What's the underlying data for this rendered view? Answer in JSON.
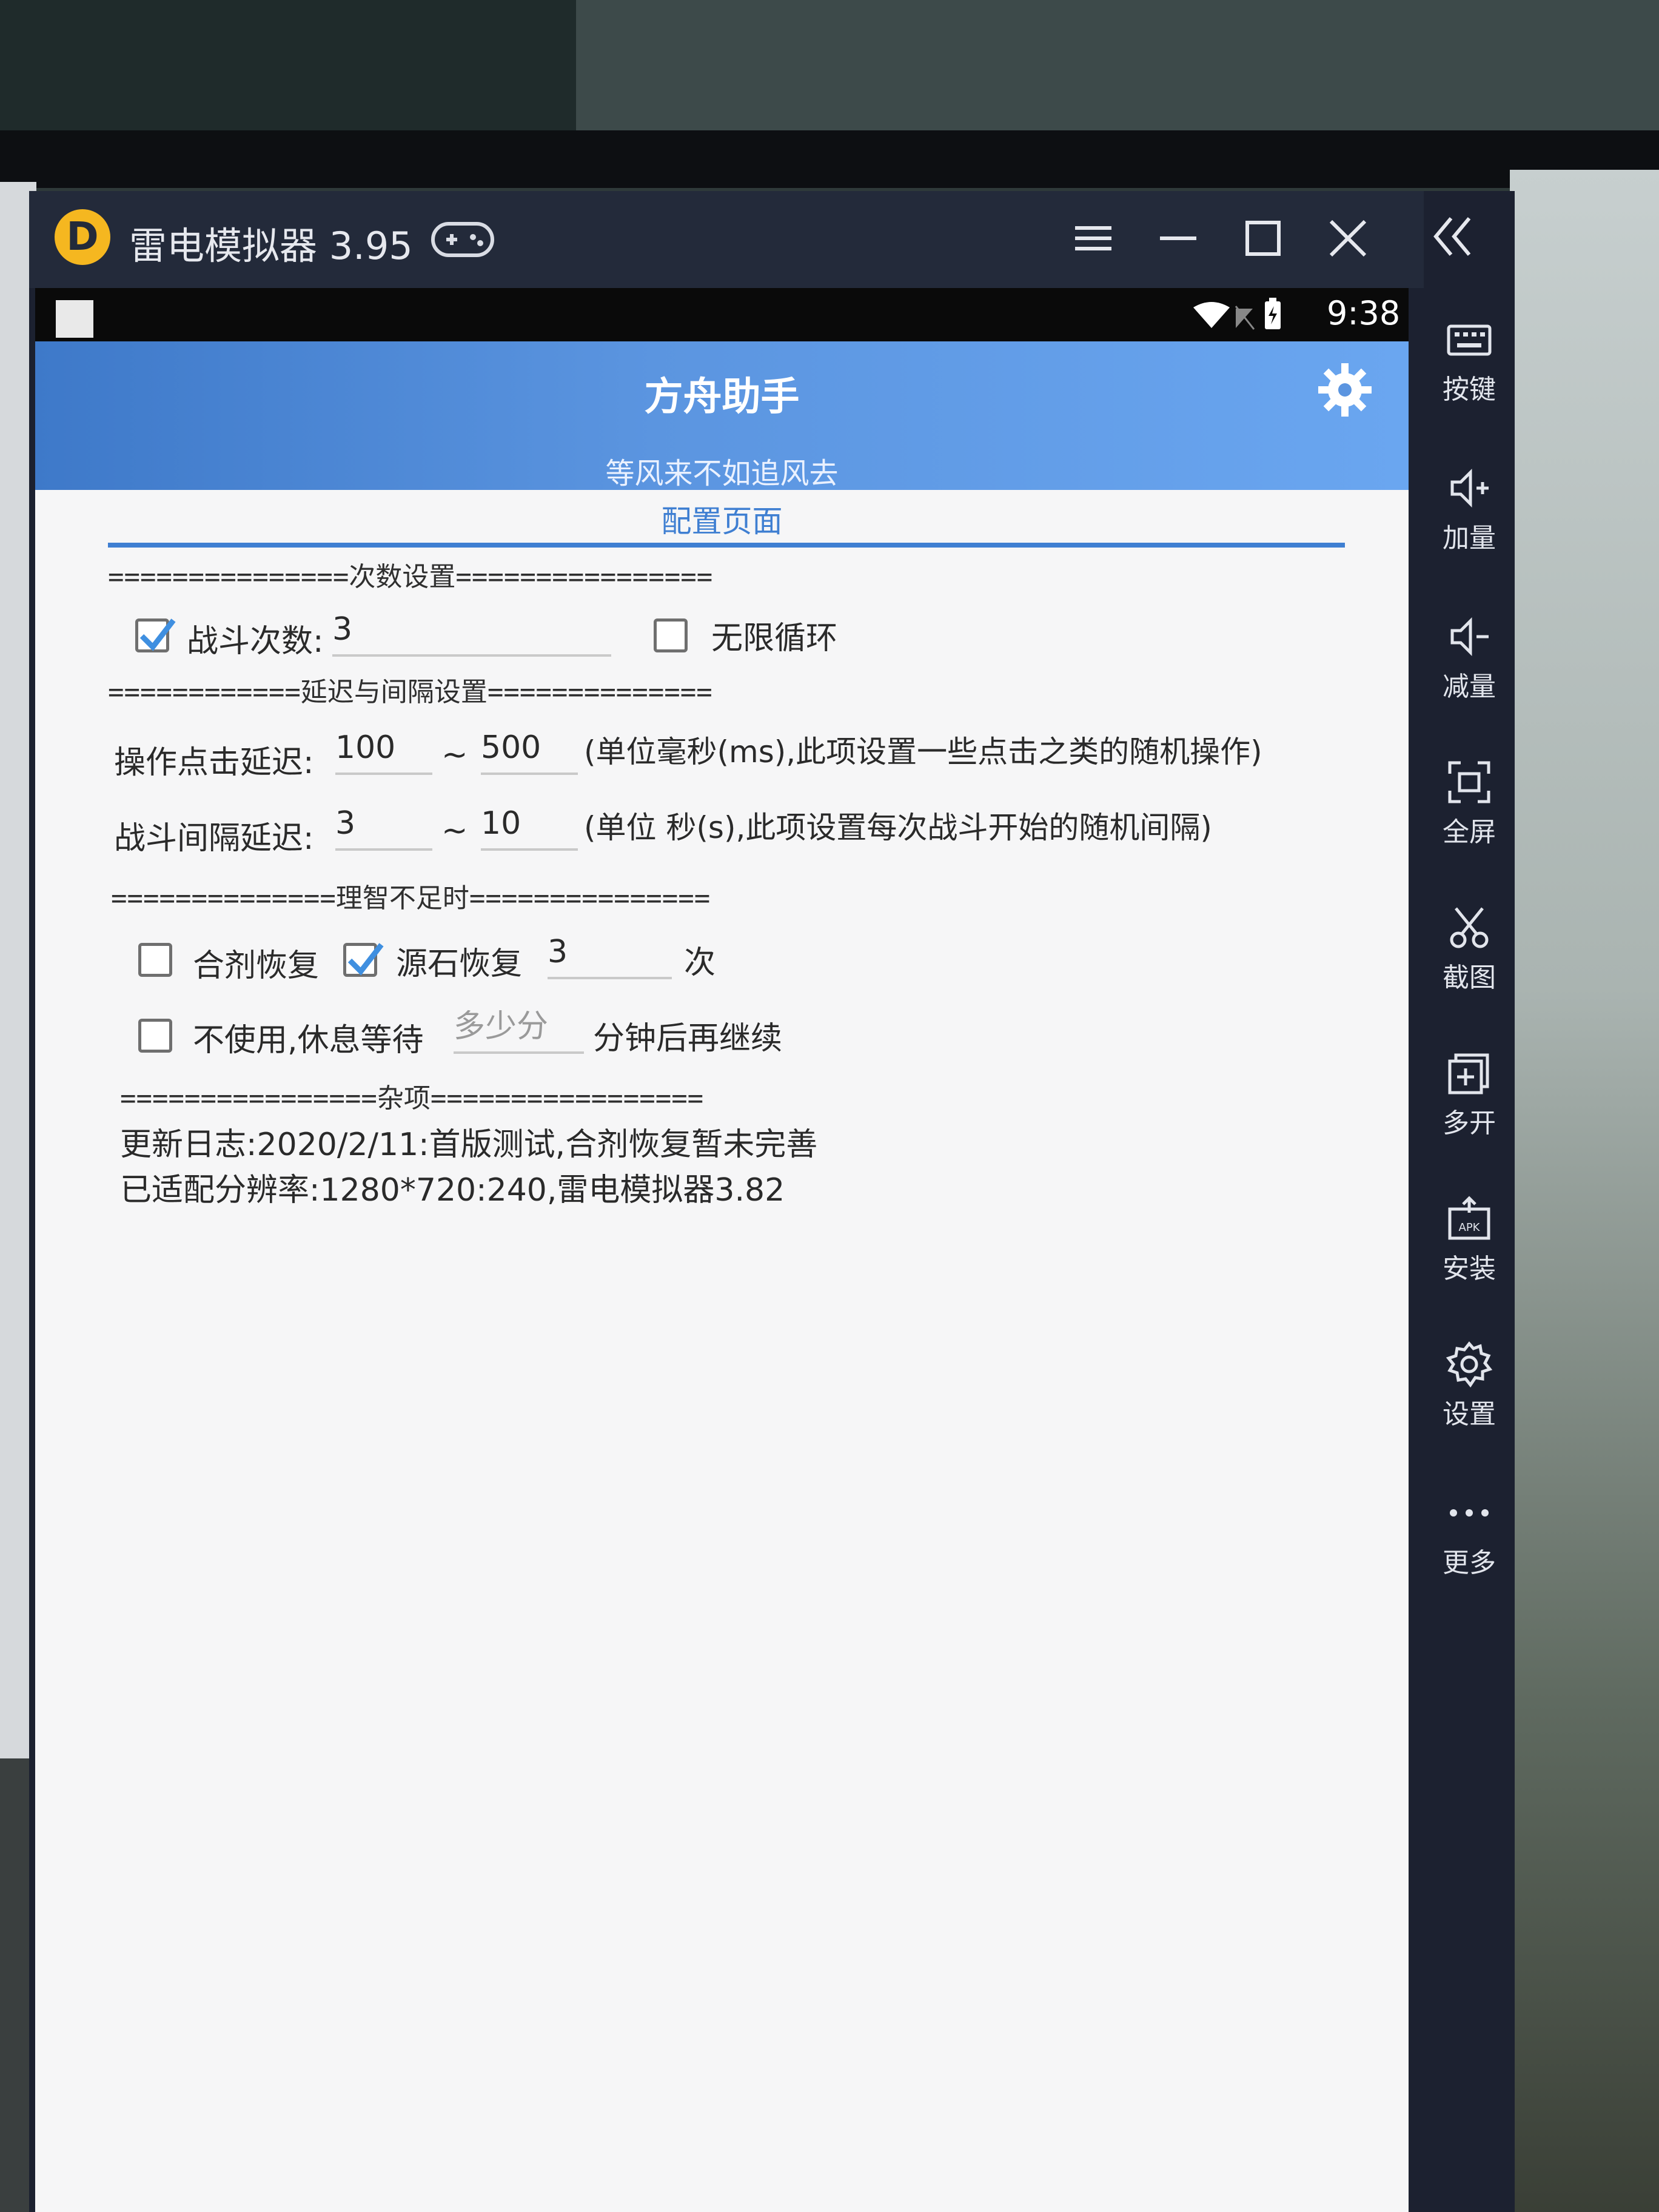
{
  "window": {
    "title": "雷电模拟器 3.95",
    "logo_glyph": "D"
  },
  "statusbar": {
    "time": "9:38"
  },
  "app": {
    "name": "方舟助手",
    "subtitle": "等风来不如追风去",
    "tab": "配置页面"
  },
  "sections": {
    "count": "===============次数设置================",
    "delay": "============延迟与间隔设置==============",
    "sanity": "==============理智不足时===============",
    "misc": "================杂项================="
  },
  "count_settings": {
    "battle_count_label": "战斗次数:",
    "battle_count_value": "3",
    "battle_count_checked": true,
    "infinite_label": "无限循环",
    "infinite_checked": false
  },
  "delay_settings": {
    "click_delay_label": "操作点击延迟:",
    "click_delay_min": "100",
    "click_delay_max": "500",
    "click_delay_note": "(单位毫秒(ms),此项设置一些点击之类的随机操作)",
    "battle_interval_label": "战斗间隔延迟:",
    "battle_interval_min": "3",
    "battle_interval_max": "10",
    "battle_interval_note": "(单位 秒(s),此项设置每次战斗开始的随机间隔)",
    "tilde": "~"
  },
  "sanity_settings": {
    "potion_label": "合剂恢复",
    "potion_checked": false,
    "originium_label": "源石恢复",
    "originium_checked": true,
    "originium_count": "3",
    "times_unit": "次",
    "wait_label": "不使用,休息等待",
    "wait_checked": false,
    "wait_minutes_placeholder": "多少分",
    "wait_suffix": "分钟后再继续"
  },
  "misc": {
    "changelog": "更新日志:2020/2/11:首版测试,合剂恢复暂未完善",
    "resolution": "已适配分辨率:1280*720:240,雷电模拟器3.82"
  },
  "toolbar": {
    "items": [
      {
        "label": "按键",
        "icon": "keyboard-icon"
      },
      {
        "label": "加量",
        "icon": "volume-up-icon"
      },
      {
        "label": "减量",
        "icon": "volume-down-icon"
      },
      {
        "label": "全屏",
        "icon": "fullscreen-icon"
      },
      {
        "label": "截图",
        "icon": "scissors-icon"
      },
      {
        "label": "多开",
        "icon": "multi-instance-icon"
      },
      {
        "label": "安装",
        "icon": "apk-install-icon"
      },
      {
        "label": "设置",
        "icon": "gear-icon"
      },
      {
        "label": "更多",
        "icon": "more-dots-icon"
      }
    ]
  },
  "colors": {
    "header_blue": "#5b95e0",
    "tab_blue": "#3f7fd2",
    "emulator_dark": "#1c2130",
    "logo_yellow": "#f5b720",
    "checkbox_tick": "#3f8fe0"
  }
}
